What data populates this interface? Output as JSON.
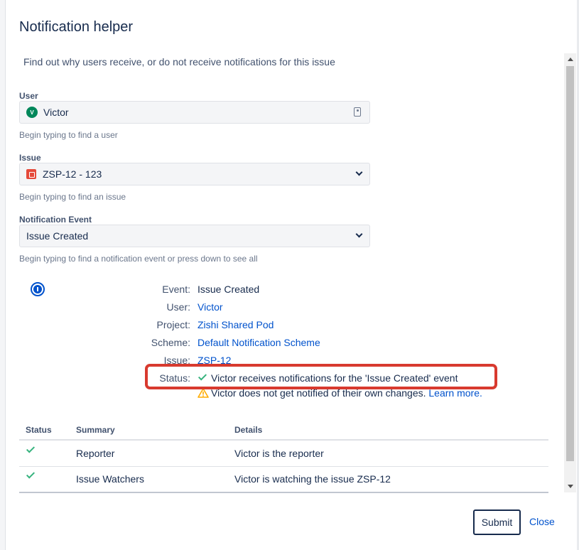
{
  "dialog": {
    "title": "Notification helper",
    "intro": "Find out why users receive, or do not receive notifications for this issue"
  },
  "form": {
    "user": {
      "label": "User",
      "value": "Victor",
      "avatar_initial": "V",
      "help": "Begin typing to find a user"
    },
    "issue": {
      "label": "Issue",
      "value": "ZSP-12 - 123",
      "help": "Begin typing to find an issue"
    },
    "event": {
      "label": "Notification Event",
      "value": "Issue Created",
      "help": "Begin typing to find a notification event or press down to see all"
    }
  },
  "details": {
    "event_key": "Event:",
    "event_val": "Issue Created",
    "user_key": "User:",
    "user_val": "Victor",
    "project_key": "Project:",
    "project_val": "Zishi Shared Pod",
    "scheme_key": "Scheme:",
    "scheme_val": "Default Notification Scheme",
    "issue_key": "Issue:",
    "issue_val": "ZSP-12",
    "status_key": "Status:",
    "status_val": "Victor receives notifications for the 'Issue Created' event",
    "warning_text": "Victor does not get notified of their own changes.",
    "learn_more": "Learn more."
  },
  "table": {
    "headers": [
      "Status",
      "Summary",
      "Details"
    ],
    "rows": [
      {
        "summary": "Reporter",
        "details": "Victor is the reporter"
      },
      {
        "summary": "Issue Watchers",
        "details": "Victor is watching the issue ZSP-12"
      }
    ]
  },
  "footer": {
    "submit_label": "Submit",
    "close_label": "Close"
  },
  "colors": {
    "link": "#0052cc",
    "success": "#36b37e",
    "warning": "#ffab00",
    "highlight": "#d83a2f",
    "bug": "#e5493a",
    "avatar": "#00875a"
  },
  "icons": [
    "user-picker-icon",
    "bug-icon",
    "chevron-down-icon",
    "info-icon",
    "check-icon",
    "warning-icon"
  ]
}
